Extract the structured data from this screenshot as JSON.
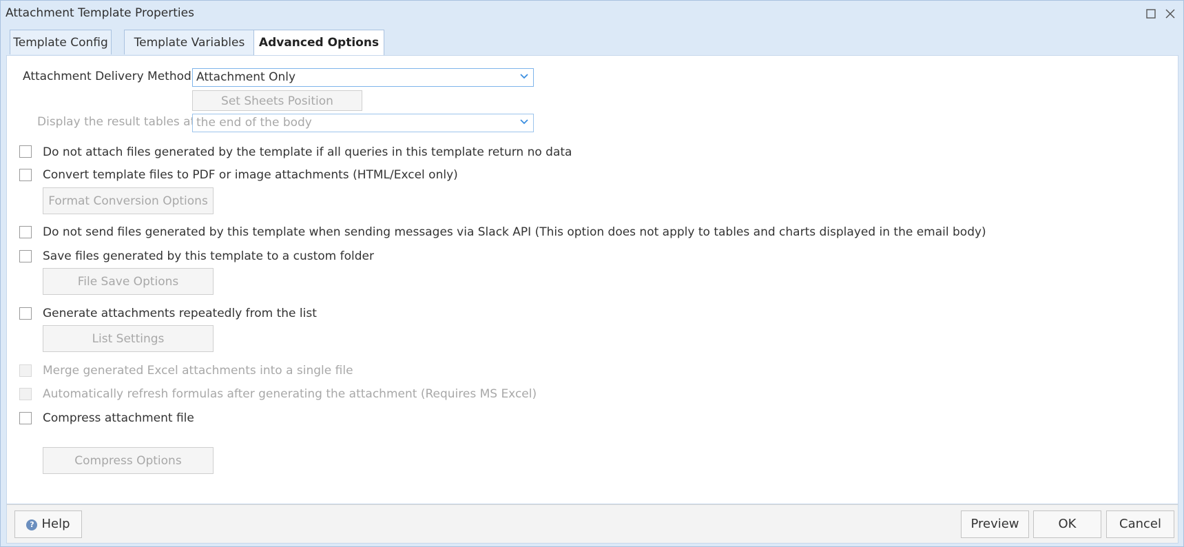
{
  "window": {
    "title": "Attachment Template Properties",
    "maximize_icon": "maximize-icon",
    "close_icon": "close-icon"
  },
  "tabs": [
    {
      "label": "Template Config"
    },
    {
      "label": "Template Variables"
    },
    {
      "label": "Advanced Options",
      "active": true
    }
  ],
  "delivery": {
    "label": "Attachment Delivery Method",
    "value": "Attachment Only",
    "set_sheets_button": "Set Sheets Position"
  },
  "display_tables": {
    "label": "Display the result tables at",
    "value": "the end of the body"
  },
  "options": [
    {
      "label": "Do not attach files generated by the template if all queries in this template return no data",
      "checked": false
    },
    {
      "label": "Convert template files to PDF or image attachments (HTML/Excel only)",
      "checked": false,
      "button": "Format Conversion Options"
    },
    {
      "label": "Do not send files generated by this template when sending messages via Slack API (This option does not apply to tables and charts displayed in the email body)",
      "checked": false
    },
    {
      "label": "Save files generated by this template to a custom folder",
      "checked": false,
      "button": "File Save Options"
    },
    {
      "label": "Generate attachments repeatedly from the list",
      "checked": false,
      "button": "List Settings"
    },
    {
      "label": "Merge generated Excel attachments into a single file",
      "checked": false,
      "disabled": true
    },
    {
      "label": "Automatically refresh formulas after generating the attachment (Requires MS Excel)",
      "checked": false,
      "disabled": true
    },
    {
      "label": "Compress attachment file",
      "checked": false,
      "button": "Compress Options"
    }
  ],
  "footer": {
    "help": "Help",
    "help_icon": "help-icon",
    "preview": "Preview",
    "ok": "OK",
    "cancel": "Cancel"
  },
  "colors": {
    "window_frame": "#dce9f7",
    "select_border": "#7eb4ea",
    "disabled_text": "#a8a8a8"
  }
}
